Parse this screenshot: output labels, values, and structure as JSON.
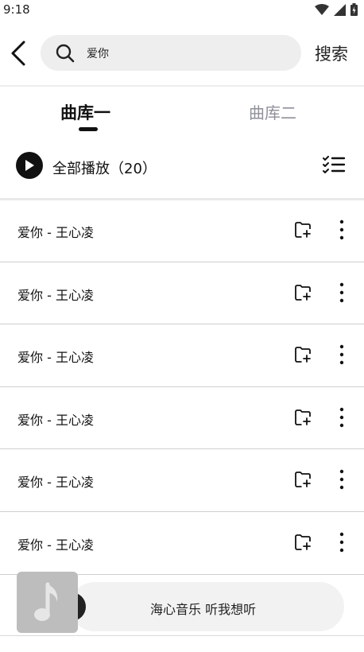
{
  "status_bar": {
    "time": "9:18"
  },
  "search": {
    "query": "爱你",
    "action_label": "搜索"
  },
  "tabs": [
    {
      "label": "曲库一",
      "active": true
    },
    {
      "label": "曲库二",
      "active": false
    }
  ],
  "play_all": {
    "label": "全部播放（20）"
  },
  "songs": [
    {
      "title": "爱你 - 王心凌"
    },
    {
      "title": "爱你 - 王心凌"
    },
    {
      "title": "爱你 - 王心凌"
    },
    {
      "title": "爱你 - 王心凌"
    },
    {
      "title": "爱你 - 王心凌"
    },
    {
      "title": "爱你 - 王心凌"
    }
  ],
  "player": {
    "now_playing": "海心音乐 听我想听"
  },
  "colors": {
    "accent": "#111111",
    "inactive_tab": "#8f9198",
    "search_bg": "#eeeeee",
    "player_bg": "#f2f2f2"
  },
  "icons": {
    "back": "chevron-left-icon",
    "search": "search-icon",
    "play": "play-icon",
    "multiselect": "checklist-icon",
    "add_to_playlist": "folder-add-icon",
    "more": "more-vertical-icon",
    "album": "music-note-icon"
  }
}
